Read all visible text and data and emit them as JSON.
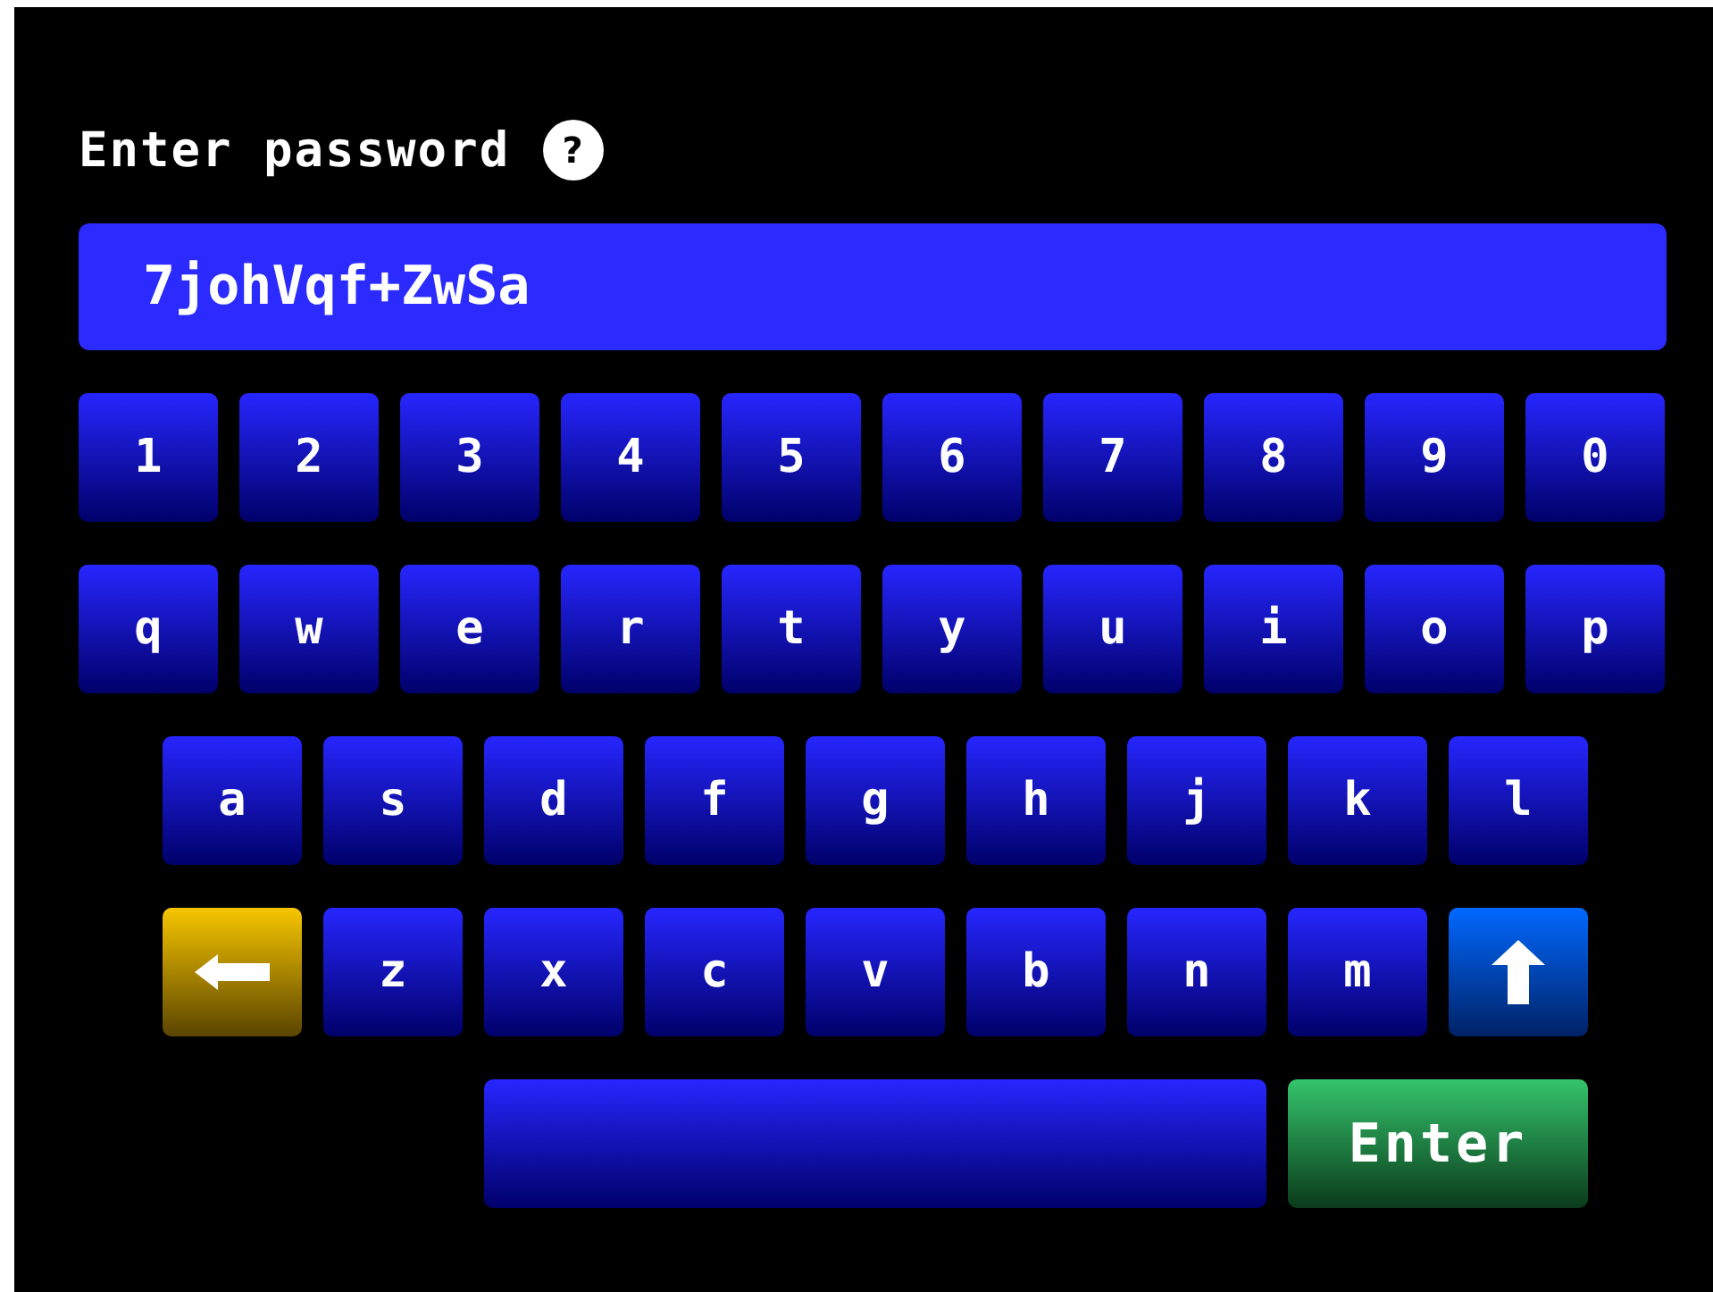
{
  "title": "Enter password",
  "help": "?",
  "password_field": {
    "value": "7johVqf+ZwSa"
  },
  "keyboard": {
    "rows": [
      {
        "keys": [
          {
            "kind": "char",
            "label": "1"
          },
          {
            "kind": "char",
            "label": "2"
          },
          {
            "kind": "char",
            "label": "3"
          },
          {
            "kind": "char",
            "label": "4"
          },
          {
            "kind": "char",
            "label": "5"
          },
          {
            "kind": "char",
            "label": "6"
          },
          {
            "kind": "char",
            "label": "7"
          },
          {
            "kind": "char",
            "label": "8"
          },
          {
            "kind": "char",
            "label": "9"
          },
          {
            "kind": "char",
            "label": "0"
          }
        ]
      },
      {
        "keys": [
          {
            "kind": "char",
            "label": "q"
          },
          {
            "kind": "char",
            "label": "w"
          },
          {
            "kind": "char",
            "label": "e"
          },
          {
            "kind": "char",
            "label": "r"
          },
          {
            "kind": "char",
            "label": "t"
          },
          {
            "kind": "char",
            "label": "y"
          },
          {
            "kind": "char",
            "label": "u"
          },
          {
            "kind": "char",
            "label": "i"
          },
          {
            "kind": "char",
            "label": "o"
          },
          {
            "kind": "char",
            "label": "p"
          }
        ]
      },
      {
        "keys": [
          {
            "kind": "char",
            "label": "a"
          },
          {
            "kind": "char",
            "label": "s"
          },
          {
            "kind": "char",
            "label": "d"
          },
          {
            "kind": "char",
            "label": "f"
          },
          {
            "kind": "char",
            "label": "g"
          },
          {
            "kind": "char",
            "label": "h"
          },
          {
            "kind": "char",
            "label": "j"
          },
          {
            "kind": "char",
            "label": "k"
          },
          {
            "kind": "char",
            "label": "l"
          }
        ]
      },
      {
        "keys": [
          {
            "kind": "backspace"
          },
          {
            "kind": "char",
            "label": "z"
          },
          {
            "kind": "char",
            "label": "x"
          },
          {
            "kind": "char",
            "label": "c"
          },
          {
            "kind": "char",
            "label": "v"
          },
          {
            "kind": "char",
            "label": "b"
          },
          {
            "kind": "char",
            "label": "n"
          },
          {
            "kind": "char",
            "label": "m"
          },
          {
            "kind": "shift"
          }
        ]
      },
      {
        "keys": [
          {
            "kind": "space"
          },
          {
            "kind": "enter",
            "label": "Enter"
          }
        ]
      }
    ]
  }
}
